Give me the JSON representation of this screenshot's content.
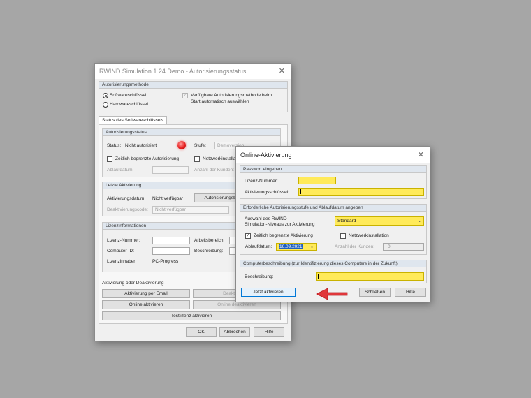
{
  "main_window": {
    "title": "RWIND Simulation 1.24 Demo - Autorisierungsstatus",
    "close_symbol": "✕",
    "method_group": {
      "header": "Autorisierungsmethode",
      "radio_software": "Softwareschlüssel",
      "radio_hardware": "Hardwareschlüssel",
      "auto_check_line1": "Verfügbare Autorisierungsmethode beim",
      "auto_check_line2": "Start automatisch auswählen"
    },
    "tab_label": "Status des Softwareschlüssels",
    "status_group": {
      "header": "Autorisierungsstatus",
      "status_label": "Status:",
      "status_value": "Nicht autorisiert",
      "level_label": "Stufe:",
      "level_value": "Demoversion",
      "time_limited_label": "Zeitlich begrenzte Autorisierung",
      "network_label": "Netzwerkinstallation",
      "expiry_label": "Ablaufdatum:",
      "customers_label": "Anzahl der Kunden:"
    },
    "last_activation_group": {
      "header": "Letzte Aktivierung",
      "activation_date_label": "Aktivierungsdatum:",
      "activation_date_value": "Nicht verfügbar",
      "auth_button": "Autorisierungsber",
      "deactivation_code_label": "Deaktivierungscode:",
      "deactivation_code_value": "Nicht verfügbar"
    },
    "license_group": {
      "header": "Lizenzinformationen",
      "license_number_label": "Lizenz-Nummer:",
      "workspace_label": "Arbeitsbereich:",
      "computer_id_label": "Computer-ID:",
      "description_label": "Beschreibung:",
      "owner_label": "Lizenzinhaber:",
      "owner_value": "PC-Progress"
    },
    "activation_section": {
      "header": "Aktivierung oder Deaktivierung",
      "btn_email_activate": "Aktivierung per Email",
      "btn_email_deactivate": "Deaktivierung",
      "btn_online_activate": "Online aktivieren",
      "btn_online_deactivate": "Online deaktivieren",
      "btn_test_license": "Testlizenz aktivieren"
    },
    "footer": {
      "ok": "OK",
      "cancel": "Abbrechen",
      "help": "Hilfe"
    }
  },
  "online_dialog": {
    "title": "Online-Aktivierung",
    "close_symbol": "✕",
    "password_group": {
      "header": "Passwort eingeben",
      "license_number_label": "Lizenz-Nummer:",
      "license_number_value": "",
      "activation_key_label": "Aktivierungsschlüssel:",
      "activation_key_value": ""
    },
    "level_group": {
      "header": "Erforderliche Autorisierungsstufe und Ablaufdatum angeben",
      "selection_label_line1": "Auswahl des RWIND",
      "selection_label_line2": "Simulation-Niveaus zur Aktivierung",
      "level_selected": "Standard",
      "time_limited_label": "Zeitlich begrenzte Aktivierung",
      "time_limited_checked": true,
      "network_label": "Netzwerkinstallation",
      "expiry_label": "Ablaufdatum:",
      "expiry_value": "16.09.2021",
      "customers_label": "Anzahl der Kunden:",
      "customers_value": "0"
    },
    "computer_group": {
      "header": "Computerbeschreibung (zur Identifizierung dieses Computers in der Zukunft)",
      "description_label": "Beschreibung:",
      "description_value": ""
    },
    "buttons": {
      "activate_now": "Jetzt aktivieren",
      "close": "Schließen",
      "help": "Hilfe"
    }
  },
  "icons": {
    "status_led": "red-status-led-icon",
    "dropdown": "chevron-down-icon",
    "annotation_arrow": "red-arrow-left-icon"
  },
  "colors": {
    "required_field": "#ffea5a",
    "status_led": "#e82020",
    "annotation_arrow": "#e0363a",
    "primary_button_border": "#0078d7"
  }
}
